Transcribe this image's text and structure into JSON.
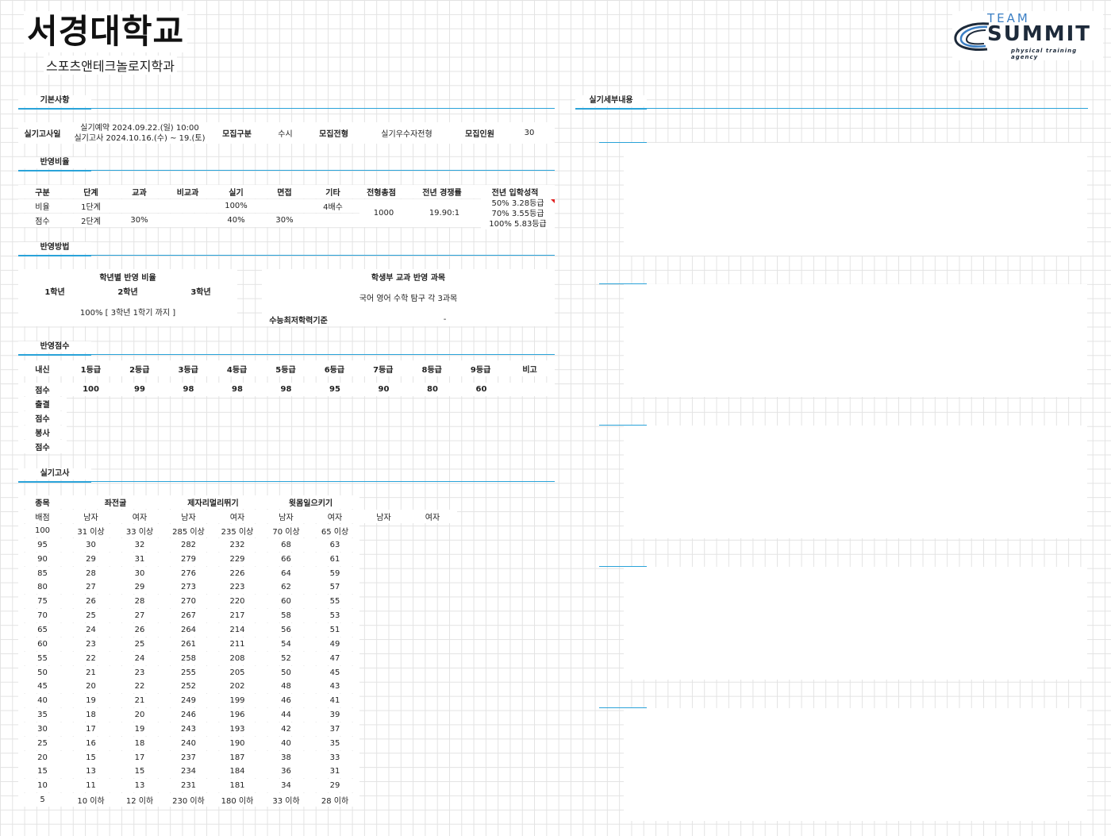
{
  "header": {
    "university": "서경대학교",
    "department": "스포츠앤테크놀로지학과",
    "logo": {
      "team": "TEAM",
      "name": "SUMMIT",
      "tagline": "physical training agency"
    }
  },
  "basic": {
    "section": "기본사항",
    "exam_date_label": "실기고사일",
    "exam_date_line1": "실기예약 2024.09.22.(일) 10:00",
    "exam_date_line2": "실기고사 2024.10.16.(수) ~ 19.(토)",
    "type_label": "모집구분",
    "type_value": "수시",
    "track_label": "모집전형",
    "track_value": "실기우수자전형",
    "quota_label": "모집인원",
    "quota_value": "30"
  },
  "ratio": {
    "section": "반영비율",
    "headers": [
      "구분",
      "단계",
      "교과",
      "비교과",
      "실기",
      "면접",
      "기타",
      "전형총점",
      "전년 경쟁률",
      "전년 입학성적"
    ],
    "row1": [
      "비율",
      "1단계",
      "",
      "",
      "100%",
      "",
      "4배수"
    ],
    "row2": [
      "점수",
      "2단계",
      "30%",
      "",
      "40%",
      "30%",
      ""
    ],
    "total": "1000",
    "competition": "19.90:1",
    "prev_scores": [
      "50% 3.28등급",
      "70% 3.55등급",
      "100% 5.83등급"
    ]
  },
  "method": {
    "section": "반영방법",
    "grade_ratio_title": "학년별 반영 비율",
    "grades": [
      "1학년",
      "2학년",
      "3학년"
    ],
    "grade_ratio_value": "100% [ 3학년 1학기 까지 ]",
    "subjects_title": "학생부 교과 반영 과목",
    "subjects_value": "국어 영어 수학 탐구 각 3과목",
    "csat_label": "수능최저학력기준",
    "csat_value": "-"
  },
  "scores": {
    "section": "반영점수",
    "headers": [
      "내신",
      "1등급",
      "2등급",
      "3등급",
      "4등급",
      "5등급",
      "6등급",
      "7등급",
      "8등급",
      "9등급",
      "비고"
    ],
    "score_label": "점수",
    "score_values": [
      "100",
      "99",
      "98",
      "98",
      "98",
      "95",
      "90",
      "80",
      "60"
    ],
    "extra_labels": [
      "출결",
      "점수",
      "봉사",
      "점수"
    ]
  },
  "practical": {
    "section": "실기고사",
    "event_label": "종목",
    "events": [
      "좌전굴",
      "제자리멀리뛰기",
      "윗몸일으키기"
    ],
    "points_label": "배점",
    "genders": [
      "남자",
      "여자",
      "남자",
      "여자",
      "남자",
      "여자",
      "남자",
      "여자"
    ],
    "rows": [
      [
        "100",
        "31 이상",
        "33 이상",
        "285 이상",
        "235 이상",
        "70 이상",
        "65 이상"
      ],
      [
        "95",
        "30",
        "32",
        "282",
        "232",
        "68",
        "63"
      ],
      [
        "90",
        "29",
        "31",
        "279",
        "229",
        "66",
        "61"
      ],
      [
        "85",
        "28",
        "30",
        "276",
        "226",
        "64",
        "59"
      ],
      [
        "80",
        "27",
        "29",
        "273",
        "223",
        "62",
        "57"
      ],
      [
        "75",
        "26",
        "28",
        "270",
        "220",
        "60",
        "55"
      ],
      [
        "70",
        "25",
        "27",
        "267",
        "217",
        "58",
        "53"
      ],
      [
        "65",
        "24",
        "26",
        "264",
        "214",
        "56",
        "51"
      ],
      [
        "60",
        "23",
        "25",
        "261",
        "211",
        "54",
        "49"
      ],
      [
        "55",
        "22",
        "24",
        "258",
        "208",
        "52",
        "47"
      ],
      [
        "50",
        "21",
        "23",
        "255",
        "205",
        "50",
        "45"
      ],
      [
        "45",
        "20",
        "22",
        "252",
        "202",
        "48",
        "43"
      ],
      [
        "40",
        "19",
        "21",
        "249",
        "199",
        "46",
        "41"
      ],
      [
        "35",
        "18",
        "20",
        "246",
        "196",
        "44",
        "39"
      ],
      [
        "30",
        "17",
        "19",
        "243",
        "193",
        "42",
        "37"
      ],
      [
        "25",
        "16",
        "18",
        "240",
        "190",
        "40",
        "35"
      ],
      [
        "20",
        "15",
        "17",
        "237",
        "187",
        "38",
        "33"
      ],
      [
        "15",
        "13",
        "15",
        "234",
        "184",
        "36",
        "31"
      ],
      [
        "10",
        "11",
        "13",
        "231",
        "181",
        "34",
        "29"
      ],
      [
        "5",
        "10 이하",
        "12 이하",
        "230 이하",
        "180 이하",
        "33 이하",
        "28 이하"
      ]
    ]
  },
  "detail": {
    "section": "실기세부내용"
  },
  "colors": {
    "accent": "#2aa3d9",
    "grid": "#e3e3e3",
    "logo_blue": "#3b7fc4",
    "logo_dark": "#1d2a3a"
  }
}
